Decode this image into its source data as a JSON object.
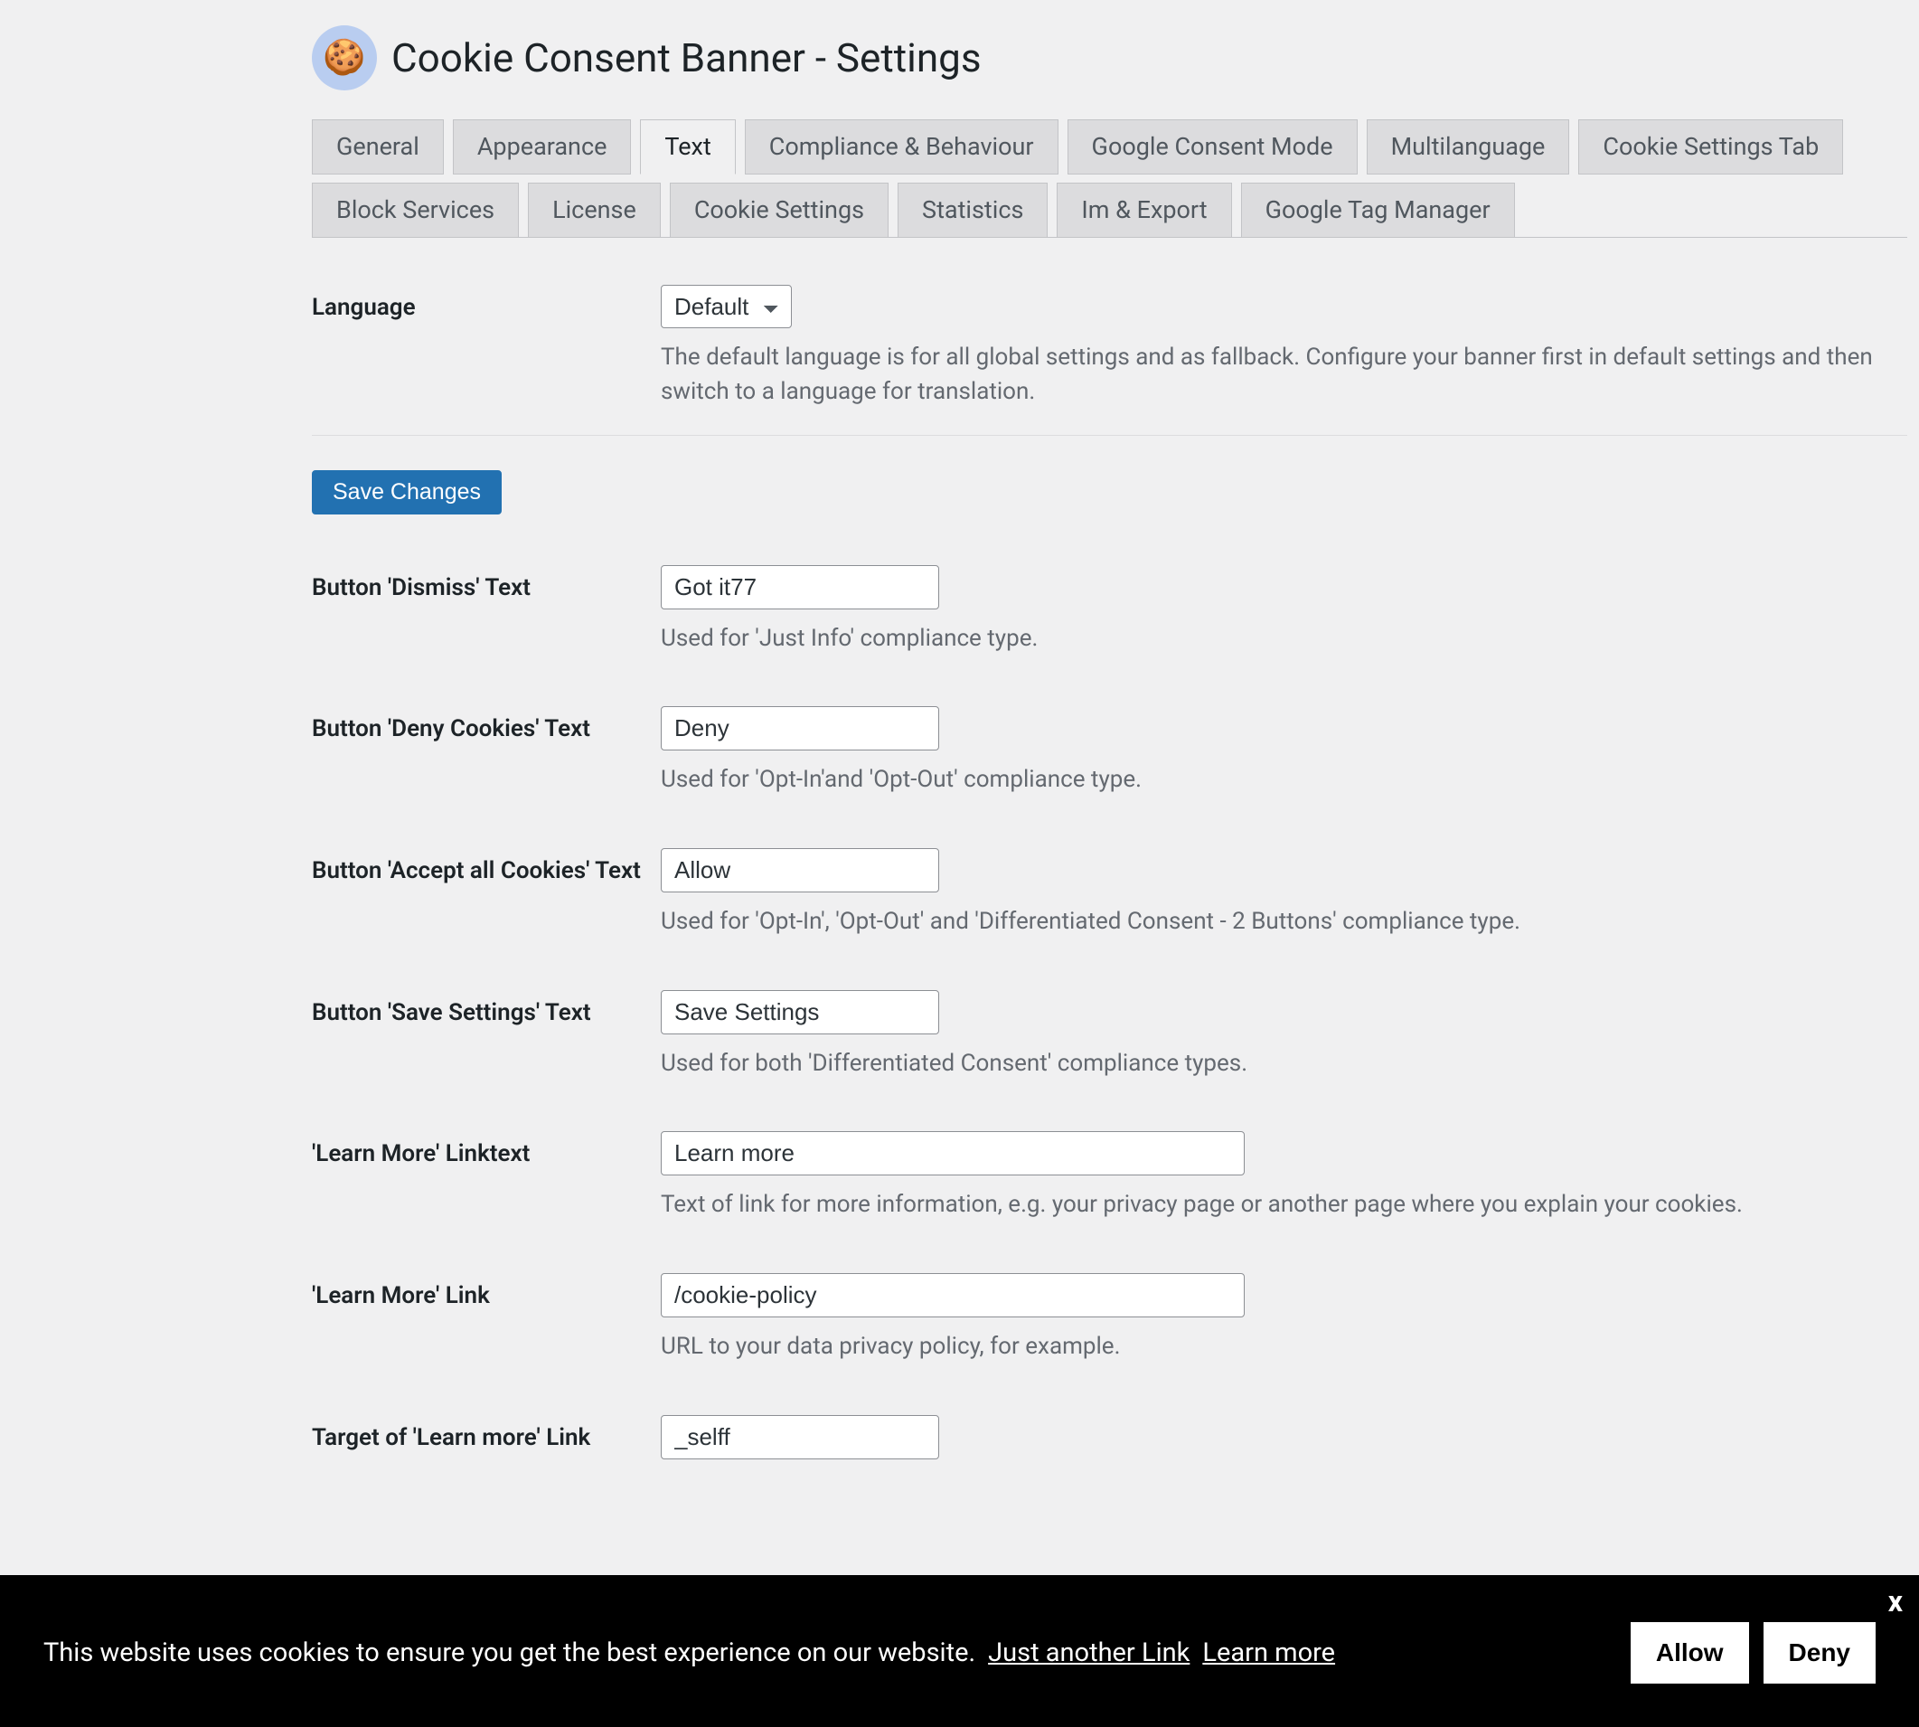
{
  "header": {
    "title": "Cookie Consent Banner - Settings",
    "logo_icon": "🍪"
  },
  "tabs": [
    {
      "id": "general",
      "label": "General",
      "active": false
    },
    {
      "id": "appearance",
      "label": "Appearance",
      "active": false
    },
    {
      "id": "text",
      "label": "Text",
      "active": true
    },
    {
      "id": "compliance",
      "label": "Compliance & Behaviour",
      "active": false
    },
    {
      "id": "gcm",
      "label": "Google Consent Mode",
      "active": false
    },
    {
      "id": "multilang",
      "label": "Multilanguage",
      "active": false
    },
    {
      "id": "settingstab",
      "label": "Cookie Settings Tab",
      "active": false
    },
    {
      "id": "block",
      "label": "Block Services",
      "active": false
    },
    {
      "id": "license",
      "label": "License",
      "active": false
    },
    {
      "id": "cookiesettings",
      "label": "Cookie Settings",
      "active": false
    },
    {
      "id": "statistics",
      "label": "Statistics",
      "active": false
    },
    {
      "id": "imexport",
      "label": "Im & Export",
      "active": false
    },
    {
      "id": "gtm",
      "label": "Google Tag Manager",
      "active": false
    }
  ],
  "language": {
    "label": "Language",
    "value": "Default",
    "desc": "The default language is for all global settings and as fallback. Configure your banner first in default settings and then switch to a language for translation."
  },
  "save_button": "Save Changes",
  "fields": [
    {
      "id": "dismiss",
      "label": "Button 'Dismiss' Text",
      "value": "Got it77",
      "desc": "Used for 'Just Info' compliance type.",
      "wide": false
    },
    {
      "id": "deny",
      "label": "Button 'Deny Cookies' Text",
      "value": "Deny",
      "desc": "Used for 'Opt-In'and 'Opt-Out' compliance type.",
      "wide": false
    },
    {
      "id": "accept",
      "label": "Button 'Accept all Cookies' Text",
      "value": "Allow",
      "desc": "Used for 'Opt-In', 'Opt-Out' and 'Differentiated Consent - 2 Buttons' compliance type.",
      "wide": false
    },
    {
      "id": "savesettings",
      "label": "Button 'Save Settings' Text",
      "value": "Save Settings",
      "desc": "Used for both 'Differentiated Consent' compliance types.",
      "wide": false
    },
    {
      "id": "learnmore_text",
      "label": "'Learn More' Linktext",
      "value": "Learn more",
      "desc": "Text of link for more information, e.g. your privacy page or another page where you explain your cookies.",
      "wide": true
    },
    {
      "id": "learnmore_link",
      "label": "'Learn More' Link",
      "value": "/cookie-policy",
      "desc": "URL to your data privacy policy, for example.",
      "wide": true
    },
    {
      "id": "learnmore_target",
      "label": "Target of 'Learn more' Link",
      "value": "_selff",
      "desc": "",
      "wide": false
    }
  ],
  "banner": {
    "message": "This website uses cookies to ensure you get the best experience on our website.",
    "link1": "Just another Link",
    "link2": "Learn more",
    "allow": "Allow",
    "deny": "Deny",
    "close": "x"
  }
}
